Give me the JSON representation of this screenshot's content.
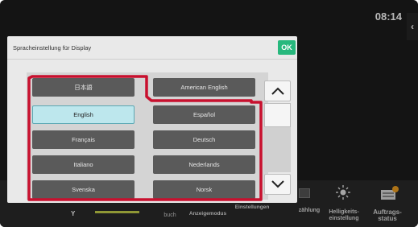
{
  "status": {
    "time": "08:14",
    "collapse_glyph": "‹"
  },
  "dialog": {
    "title": "Spracheinstellung für Display",
    "ok_label": "OK"
  },
  "languages": {
    "japanese": "日本語",
    "american_english": "American English",
    "english": "English",
    "espanol": "Español",
    "francais": "Français",
    "deutsch": "Deutsch",
    "italiano": "Italiano",
    "nederlands": "Nederlands",
    "svenska": "Svenska",
    "norsk": "Norsk"
  },
  "selected_language": "English",
  "taskbar": {
    "y_label": "Y",
    "buch": "buch",
    "anzeigemodus": "Anzeigemodus",
    "einstellungen": "Einstellungen",
    "zaehlung": "zählung",
    "helligkeit": "Helligkeits- einstellung",
    "auftrags": "Auftrags- status"
  },
  "icons": {
    "scroll_up": "chevron-up-icon",
    "scroll_down": "chevron-down-icon",
    "brightness": "sun-icon",
    "job_status": "job-status-icon"
  },
  "colors": {
    "ok_green": "#27b87d",
    "selected_cyan": "#bde7ed",
    "highlight_red": "#c8102e"
  }
}
